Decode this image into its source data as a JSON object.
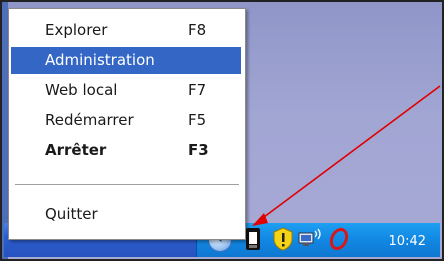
{
  "menu": {
    "items": [
      {
        "label": "Explorer",
        "shortcut": "F8"
      },
      {
        "label": "Administration",
        "shortcut": ""
      },
      {
        "label": "Web local",
        "shortcut": "F7"
      },
      {
        "label": "Redémarrer",
        "shortcut": "F5"
      },
      {
        "label": "Arrêter",
        "shortcut": "F3"
      }
    ],
    "quit_label": "Quitter",
    "selected_index": 1
  },
  "taskbar": {
    "clock": "10:42",
    "tray_icons": [
      "show-hidden-icons-icon",
      "server-app-icon",
      "security-shield-icon",
      "network-icon",
      "antivirus-icon"
    ]
  },
  "colors": {
    "selection": "#3466c6",
    "taskbar": "#2c5fce",
    "tray": "#128ae4",
    "arrow": "#e00000"
  }
}
